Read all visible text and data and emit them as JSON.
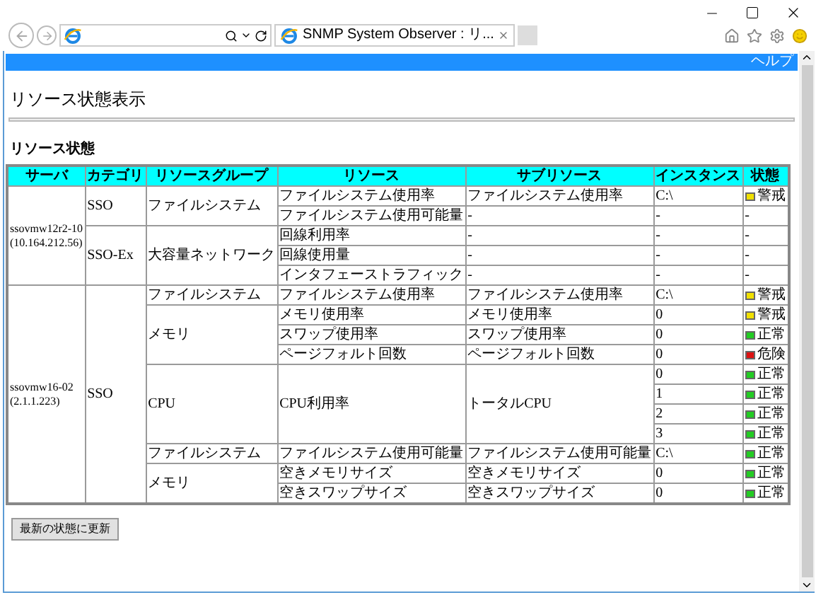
{
  "browser": {
    "tab_title": "SNMP System Observer : リ..."
  },
  "header": {
    "help_link": "ヘルプ"
  },
  "page_title": "リソース状態表示",
  "section_title": "リソース状態",
  "table": {
    "columns": [
      "サーバ",
      "カテゴリ",
      "リソースグループ",
      "リソース",
      "サブリソース",
      "インスタンス",
      "状態"
    ],
    "servers": [
      {
        "name": "ssovmw12r2-10",
        "address": "(10.164.212.56)",
        "categories": [
          {
            "name": "SSO",
            "groups": [
              {
                "name": "ファイルシステム",
                "resources": [
                  {
                    "name": "ファイルシステム使用率",
                    "subresource": "ファイルシステム使用率",
                    "instances": [
                      {
                        "value": "C:\\",
                        "color": "#f0e000",
                        "label": "警戒"
                      }
                    ]
                  },
                  {
                    "name": "ファイルシステム使用可能量",
                    "subresource": "-",
                    "instances": [
                      {
                        "value": "-",
                        "label": "-"
                      }
                    ]
                  }
                ]
              }
            ]
          },
          {
            "name": "SSO-Ex",
            "groups": [
              {
                "name": "大容量ネットワーク",
                "resources": [
                  {
                    "name": "回線利用率",
                    "subresource": "-",
                    "instances": [
                      {
                        "value": "-",
                        "label": "-"
                      }
                    ]
                  },
                  {
                    "name": "回線使用量",
                    "subresource": "-",
                    "instances": [
                      {
                        "value": "-",
                        "label": "-"
                      }
                    ]
                  },
                  {
                    "name": "インタフェーストラフィック",
                    "subresource": "-",
                    "instances": [
                      {
                        "value": "-",
                        "label": "-"
                      }
                    ]
                  }
                ]
              }
            ]
          }
        ]
      },
      {
        "name": "ssovmw16-02",
        "address": "(2.1.1.223)",
        "categories": [
          {
            "name": "SSO",
            "groups": [
              {
                "name": "ファイルシステム",
                "resources": [
                  {
                    "name": "ファイルシステム使用率",
                    "subresource": "ファイルシステム使用率",
                    "instances": [
                      {
                        "value": "C:\\",
                        "color": "#f0e000",
                        "label": "警戒"
                      }
                    ]
                  }
                ]
              },
              {
                "name": "メモリ",
                "resources": [
                  {
                    "name": "メモリ使用率",
                    "subresource": "メモリ使用率",
                    "instances": [
                      {
                        "value": "0",
                        "color": "#f0e000",
                        "label": "警戒"
                      }
                    ]
                  },
                  {
                    "name": "スワップ使用率",
                    "subresource": "スワップ使用率",
                    "instances": [
                      {
                        "value": "0",
                        "color": "#22cc22",
                        "label": "正常"
                      }
                    ]
                  },
                  {
                    "name": "ページフォルト回数",
                    "subresource": "ページフォルト回数",
                    "instances": [
                      {
                        "value": "0",
                        "color": "#dd1111",
                        "label": "危険"
                      }
                    ]
                  }
                ]
              },
              {
                "name": "CPU",
                "resources": [
                  {
                    "name": "CPU利用率",
                    "subresource": "トータルCPU",
                    "instances": [
                      {
                        "value": "0",
                        "color": "#22cc22",
                        "label": "正常"
                      },
                      {
                        "value": "1",
                        "color": "#22cc22",
                        "label": "正常"
                      },
                      {
                        "value": "2",
                        "color": "#22cc22",
                        "label": "正常"
                      },
                      {
                        "value": "3",
                        "color": "#22cc22",
                        "label": "正常"
                      }
                    ]
                  }
                ]
              },
              {
                "name": "ファイルシステム",
                "resources": [
                  {
                    "name": "ファイルシステム使用可能量",
                    "subresource": "ファイルシステム使用可能量",
                    "instances": [
                      {
                        "value": "C:\\",
                        "color": "#22cc22",
                        "label": "正常"
                      }
                    ]
                  }
                ]
              },
              {
                "name": "メモリ",
                "resources": [
                  {
                    "name": "空きメモリサイズ",
                    "subresource": "空きメモリサイズ",
                    "instances": [
                      {
                        "value": "0",
                        "color": "#22cc22",
                        "label": "正常"
                      }
                    ]
                  },
                  {
                    "name": "空きスワップサイズ",
                    "subresource": "空きスワップサイズ",
                    "instances": [
                      {
                        "value": "0",
                        "color": "#22cc22",
                        "label": "正常"
                      }
                    ]
                  }
                ]
              }
            ]
          }
        ]
      }
    ]
  },
  "refresh_button": "最新の状態に更新"
}
